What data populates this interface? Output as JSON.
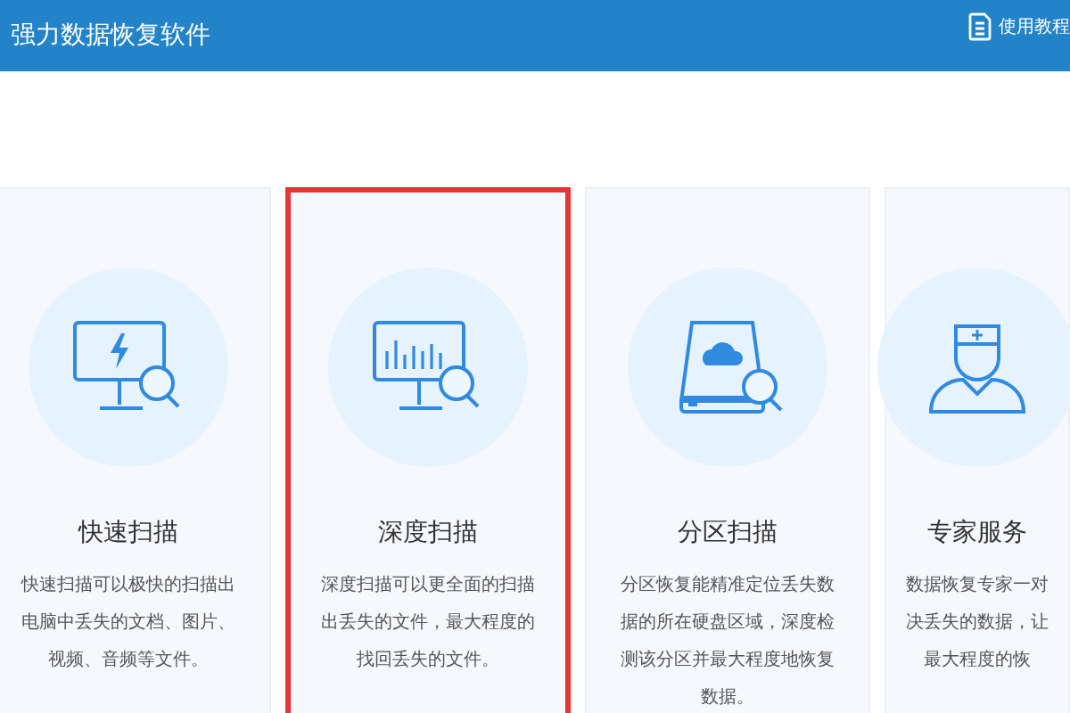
{
  "header": {
    "title": "强力数据恢复软件",
    "help_link": "使用教程"
  },
  "cards": [
    {
      "kind": "quick",
      "title": "快速扫描",
      "selected": false,
      "desc_lines": [
        "快速扫描可以极快的扫描出",
        "电脑中丢失的文档、图片、",
        "视频、音频等文件。"
      ]
    },
    {
      "kind": "deep",
      "title": "深度扫描",
      "selected": true,
      "desc_lines": [
        "深度扫描可以更全面的扫描",
        "出丢失的文件，最大程度的",
        "找回丢失的文件。"
      ]
    },
    {
      "kind": "partition",
      "title": "分区扫描",
      "selected": false,
      "desc_lines": [
        "分区恢复能精准定位丢失数",
        "据的所在硬盘区域，深度检",
        "测该分区并最大程度地恢复",
        "数据。"
      ]
    },
    {
      "kind": "expert",
      "title": "专家服务",
      "selected": false,
      "desc_lines": [
        "数据恢复专家一对",
        "决丢失的数据，让",
        "最大程度的恢"
      ]
    }
  ]
}
